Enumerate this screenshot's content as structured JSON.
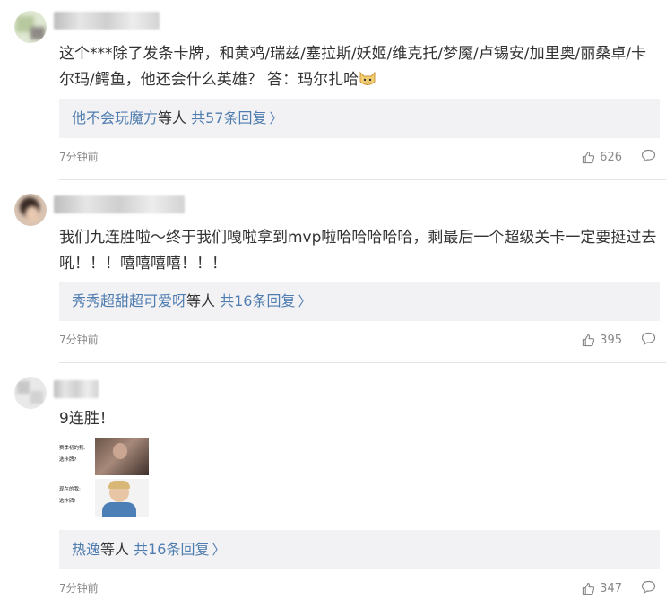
{
  "comments": [
    {
      "text": "这个***除了发条卡牌，和黄鸡/瑞兹/塞拉斯/妖姬/维克托/梦魇/卢锡安/加里奥/丽桑卓/卡尔玛/鳄鱼，他还会什么英雄？ 答：玛尔扎哈",
      "emoji": "cat-face-emoji",
      "reply_users": "他不会玩魔方",
      "reply_mid": "等人 ",
      "reply_count": "共57条回复",
      "time": "7分钟前",
      "likes": "626"
    },
    {
      "text": "我们九连胜啦～终于我们嘎啦拿到mvp啦哈哈哈哈哈，剩最后一个超级关卡一定要挺过去吼！！！嘻嘻嘻嘻！！！",
      "reply_users": "秀秀超甜超可爱呀",
      "reply_mid": "等人 ",
      "reply_count": "共16条回复",
      "time": "7分钟前",
      "likes": "395"
    },
    {
      "text": "9连胜！",
      "meme": {
        "panel1_caption": [
          "赛季初的我:",
          "选卡牌?"
        ],
        "panel2_caption": [
          "现在的我:",
          "选卡牌!"
        ]
      },
      "reply_users": "热逸",
      "reply_mid": "等人 ",
      "reply_count": "共16条回复",
      "time": "7分钟前",
      "likes": "347"
    }
  ],
  "colors": {
    "link": "#507daf",
    "reply_bg": "#f2f2f5",
    "meta": "#888888"
  },
  "icons": {
    "like": "thumbs-up-icon",
    "reply": "comment-bubble-icon"
  }
}
